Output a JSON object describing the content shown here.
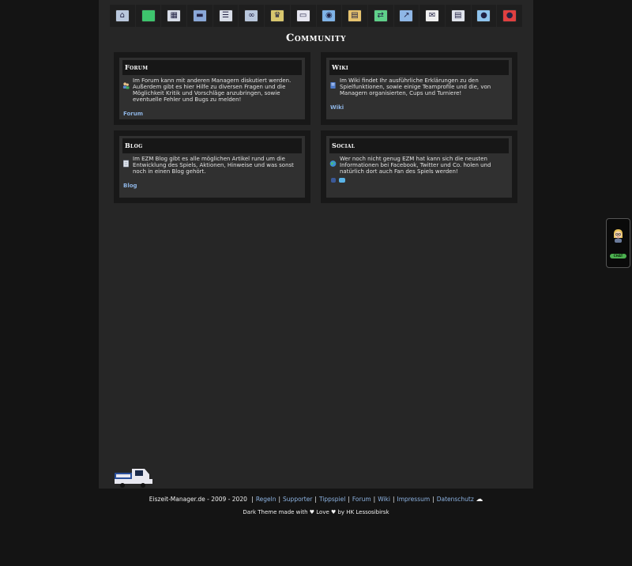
{
  "nav": {
    "items": [
      {
        "icon": "home-icon",
        "glyph": "⌂",
        "color": "#b9c7dc"
      },
      {
        "icon": "jersey-icon",
        "glyph": "",
        "color": "#3ec46d"
      },
      {
        "icon": "lineup-icon",
        "glyph": "▦",
        "color": "#d8dde8"
      },
      {
        "icon": "training-icon",
        "glyph": "▬",
        "color": "#8aa8d8"
      },
      {
        "icon": "list-icon",
        "glyph": "☰",
        "color": "#d8dde8"
      },
      {
        "icon": "vs-icon",
        "glyph": "∞",
        "color": "#b9c7dc"
      },
      {
        "icon": "trophy-icon",
        "glyph": "♛",
        "color": "#d8c66e"
      },
      {
        "icon": "rink-icon",
        "glyph": "▭",
        "color": "#e6e6f0"
      },
      {
        "icon": "arena-icon",
        "glyph": "◉",
        "color": "#7fb3e6"
      },
      {
        "icon": "finance-icon",
        "glyph": "▤",
        "color": "#e6c36e"
      },
      {
        "icon": "transfer-icon",
        "glyph": "⇄",
        "color": "#5fd08a"
      },
      {
        "icon": "stats-icon",
        "glyph": "↗",
        "color": "#8fb7e6"
      },
      {
        "icon": "mail-icon",
        "glyph": "✉",
        "color": "#f0f0f0"
      },
      {
        "icon": "document-icon",
        "glyph": "▤",
        "color": "#e0e4ec"
      },
      {
        "icon": "chat-icon",
        "glyph": "●",
        "color": "#8fc4ee"
      },
      {
        "icon": "logout-icon",
        "glyph": "●",
        "color": "#e04040"
      }
    ]
  },
  "page": {
    "title": "Community"
  },
  "cards": {
    "forum": {
      "title": "Forum",
      "text": "Im Forum kann mit anderen Managern diskutiert werden. Außerdem gibt es hier Hilfe zu diversen Fragen und die Möglichkeit Kritik und Vorschläge anzubringen, sowie eventuelle Fehler und Bugs zu melden!",
      "link": "Forum",
      "icon": "users-icon"
    },
    "wiki": {
      "title": "Wiki",
      "text": "Im Wiki findet Ihr ausführliche Erklärungen zu den Spielfunktionen, sowie einige Teamprofile und die, von Managern organisierten, Cups und Turniere!",
      "link": "Wiki",
      "icon": "book-icon"
    },
    "blog": {
      "title": "Blog",
      "text": "Im EZM Blog gibt es alle möglichen Artikel rund um die Entwicklung des Spiels, Aktionen, Hinweise und was sonst noch in einen Blog gehört.",
      "link": "Blog",
      "icon": "page-icon"
    },
    "social": {
      "title": "Social",
      "text": "Wer noch nicht genug EZM hat kann sich die neusten Informationen bei Facebook, Twitter und Co. holen und natürlich dort auch Fan des Spiels werden!",
      "icon": "globe-icon"
    }
  },
  "footer": {
    "site": "Eiszeit-Manager.de - 2009 - 2020",
    "links": [
      "Regeln",
      "Supporter",
      "Tippspiel",
      "Forum",
      "Wiki",
      "Impressum",
      "Datenschutz"
    ],
    "credit": "Dark Theme made with ♥ Love ♥ by HK Lessosibirsk"
  },
  "phone": {
    "button": "CHAT"
  },
  "colors": {
    "link": "#8db3e2",
    "panel": "#262626",
    "background": "#141414"
  }
}
